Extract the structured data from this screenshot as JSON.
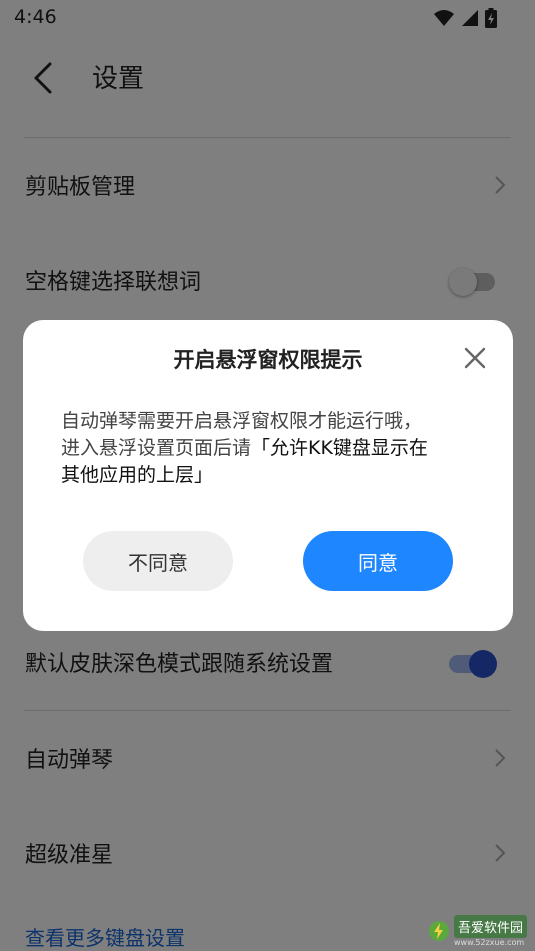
{
  "status": {
    "time": "4:46",
    "icons": [
      "wifi-icon",
      "signal-icon",
      "battery-charging-icon"
    ]
  },
  "header": {
    "title": "设置"
  },
  "rows": [
    {
      "label": "剪贴板管理",
      "control": "chevron"
    },
    {
      "label": "空格键选择联想词",
      "control": "toggle",
      "on": false
    },
    {
      "label": "默认皮肤深色模式跟随系统设置",
      "control": "toggle",
      "on": true
    },
    {
      "label": "自动弹琴",
      "control": "chevron"
    },
    {
      "label": "超级准星",
      "control": "chevron"
    }
  ],
  "more_link": "查看更多键盘设置",
  "dialog": {
    "title": "开启悬浮窗权限提示",
    "body_line1": "自动弹琴需要开启悬浮窗权限才能运行哦，",
    "body_line2_a": "进入悬浮设置页面后请",
    "body_line2_b": "「允许KK键盘显示在",
    "body_line3": "其他应用的上层」",
    "disagree": "不同意",
    "agree": "同意"
  },
  "watermark": {
    "text": "吾爱软件园",
    "url": "www.52zxue.com"
  },
  "colors": {
    "accent": "#1e86ff",
    "toggle_on": "#2a4fc9",
    "link": "#1a66d6"
  }
}
